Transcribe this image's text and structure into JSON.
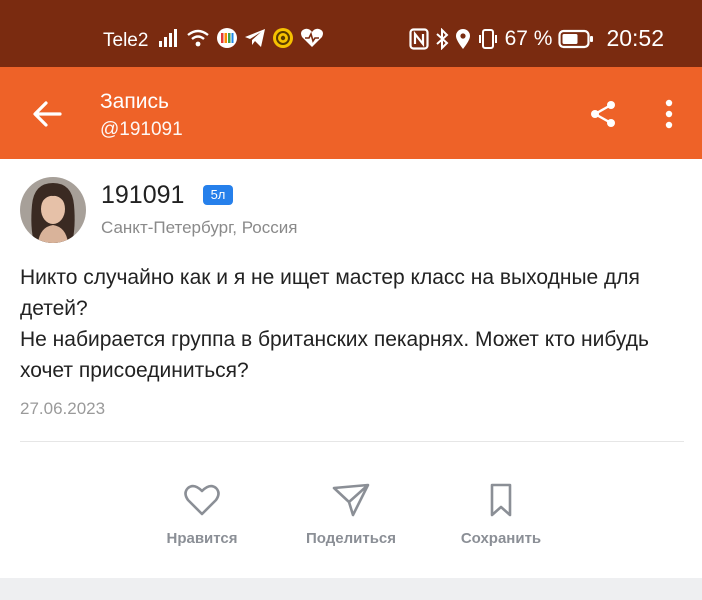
{
  "status_bar": {
    "carrier": "Tele2",
    "battery_percent": "67 %",
    "time": "20:52",
    "icons_left": [
      "signal-icon",
      "wifi-icon",
      "app-icon-colorful",
      "telegram-icon",
      "app-icon-yellow",
      "heart-app-icon"
    ],
    "icons_right": [
      "nfc-icon",
      "bluetooth-icon",
      "location-icon",
      "vibrate-icon",
      "battery-icon"
    ]
  },
  "appbar": {
    "title": "Запись",
    "subtitle": "@191091",
    "color": "#ee6228"
  },
  "post": {
    "author": {
      "name": "191091",
      "badge": "5л",
      "location": "Санкт-Петербург, Россия"
    },
    "text_lines": [
      "Никто случайно как и я не ищет мастер класс на выходные для детей?",
      "Не набирается группа в британских пекарнях. Может кто нибудь хочет присоединиться?"
    ],
    "date": "27.06.2023"
  },
  "actions": {
    "like": "Нравится",
    "share": "Поделиться",
    "save": "Сохранить"
  }
}
